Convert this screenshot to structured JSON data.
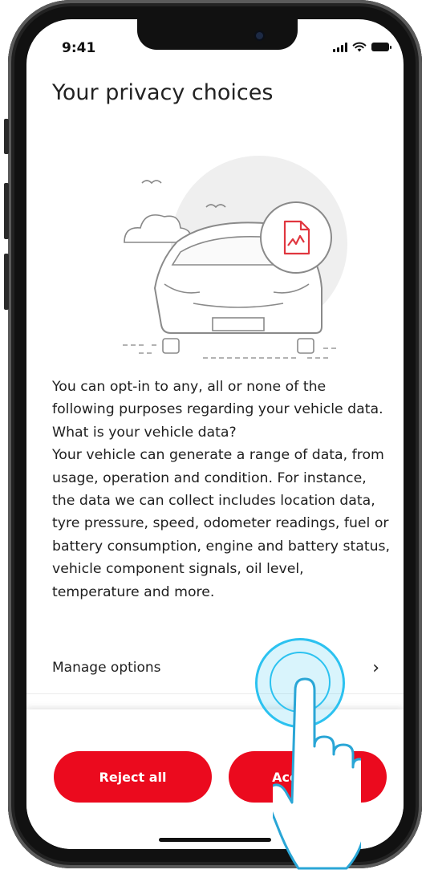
{
  "status_bar": {
    "time": "9:41",
    "signal_icon": "signal-bars-icon",
    "wifi_icon": "wifi-icon",
    "battery_icon": "battery-icon"
  },
  "screen": {
    "title": "Your privacy choices",
    "illustration": "car-with-data-document-illustration",
    "body": [
      "You can opt-in to any, all or none of the following purposes regarding your vehicle data. What is your vehicle data?",
      "Your vehicle can generate a range of data, from usage, operation and condition. For instance, the data we can collect includes location data, tyre pressure, speed, odometer readings, fuel or battery consumption, engine and battery status, vehicle component signals, oil level, temperature and more."
    ],
    "manage_options": {
      "label": "Manage options",
      "icon": "chevron-right-icon",
      "glyph": "›"
    }
  },
  "actions": {
    "reject_label": "Reject all",
    "accept_label": "Accept all"
  },
  "colors": {
    "accent": "#eb0a1e",
    "tap_highlight": "#2cc2f0",
    "text": "#1f1f1f"
  },
  "overlay": {
    "tap_icon": "tap-hand-icon"
  }
}
